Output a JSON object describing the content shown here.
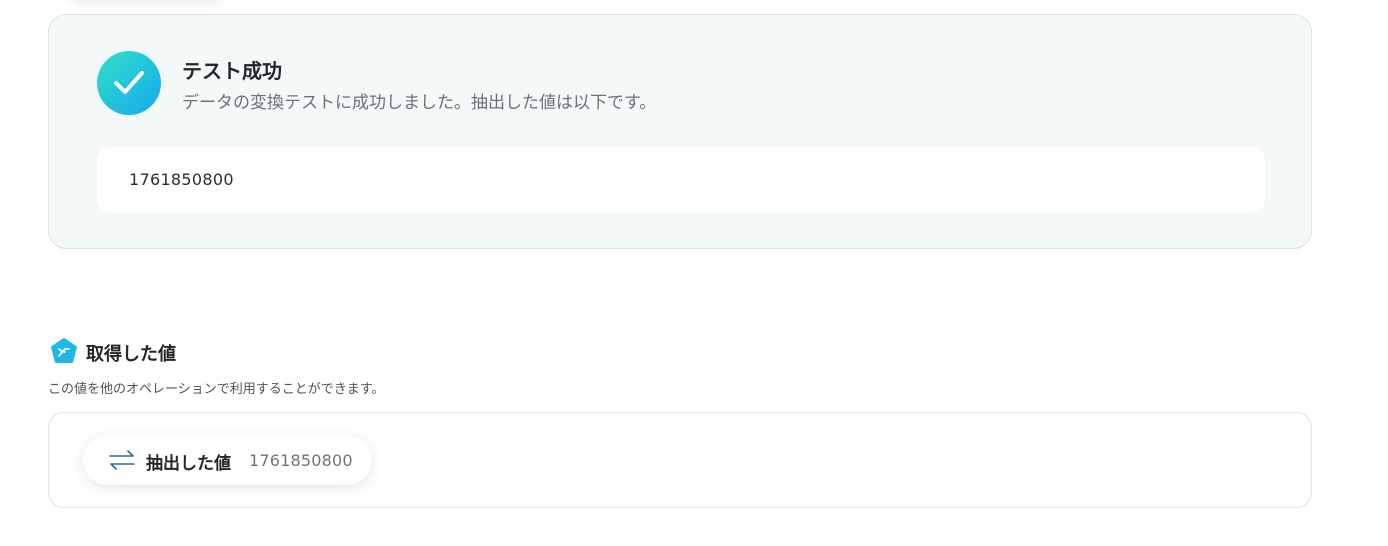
{
  "test_result": {
    "title": "テスト成功",
    "subtitle": "データの変換テストに成功しました。抽出した値は以下です。",
    "value": "1761850800",
    "icon": "check-icon",
    "accent_gradient": [
      "#34e0c6",
      "#1aa8e8"
    ]
  },
  "obtained_values": {
    "title": "取得した値",
    "description": "この値を他のオペレーションで利用することができます。",
    "icon": "pentagon-x-icon",
    "items": [
      {
        "label": "抽出した値",
        "value": "1761850800",
        "icon": "swap-arrows-icon"
      }
    ]
  }
}
